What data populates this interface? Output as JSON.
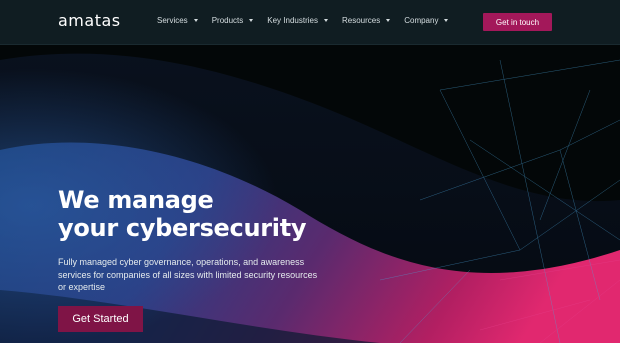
{
  "brand": {
    "logo_text": "amatas"
  },
  "nav": {
    "items": [
      {
        "label": "Services"
      },
      {
        "label": "Products"
      },
      {
        "label": "Key Industries"
      },
      {
        "label": "Resources"
      },
      {
        "label": "Company"
      }
    ],
    "cta_label": "Get in touch"
  },
  "hero": {
    "headline_line1": "We manage",
    "headline_line2": "your cybersecurity",
    "subtext": "Fully managed cyber governance, operations, and awareness services for companies of all sizes with limited security resources or expertise",
    "cta_label": "Get Started"
  },
  "colors": {
    "accent": "#a3185a",
    "accent_dark": "#7f1446",
    "nav_bg": "#101d22",
    "page_bg": "#030708",
    "wave_blue": "#1d4d8c",
    "wave_pink": "#d6236d"
  }
}
